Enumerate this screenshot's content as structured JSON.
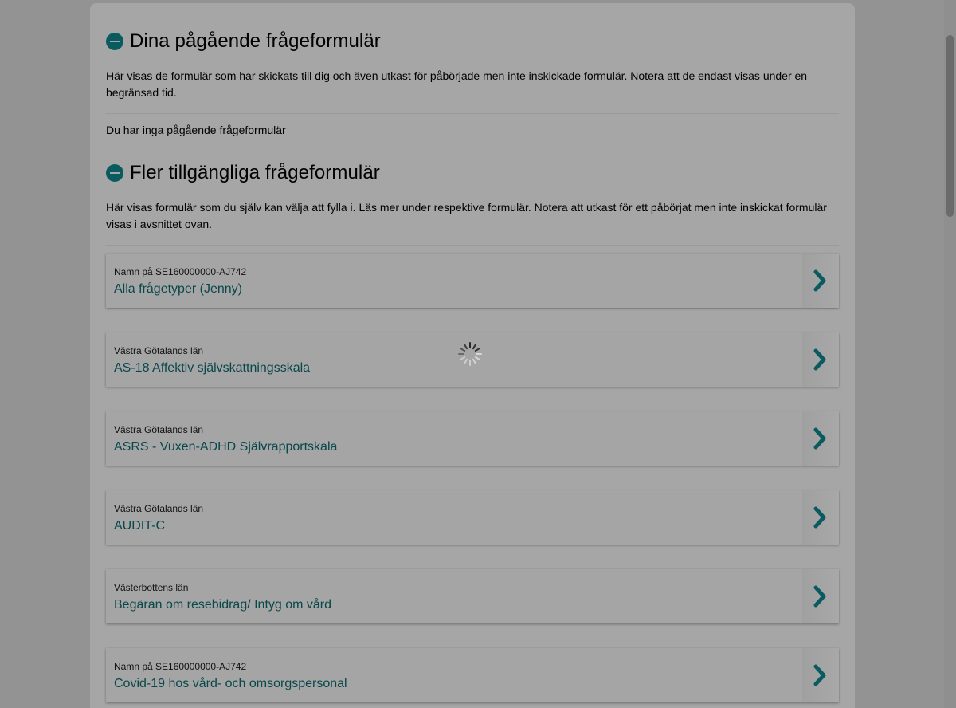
{
  "ongoing": {
    "title": "Dina pågående frågeformulär",
    "description": "Här visas de formulär som har skickats till dig och även utkast för påbörjade men inte inskickade formulär. Notera att de endast visas under en begränsad tid.",
    "empty_text": "Du har inga pågående frågeformulär"
  },
  "available": {
    "title": "Fler tillgängliga frågeformulär",
    "description": "Här visas formulär som du själv kan välja att fylla i. Läs mer under respektive formulär. Notera att utkast för ett påbörjat men inte inskickat formulär visas i avsnittet ovan.",
    "forms": [
      {
        "provider": "Namn på SE160000000-AJ742",
        "title": "Alla frågetyper (Jenny)"
      },
      {
        "provider": "Västra Götalands län",
        "title": "AS-18 Affektiv självskattningsskala"
      },
      {
        "provider": "Västra Götalands län",
        "title": "ASRS - Vuxen-ADHD Självrapportskala"
      },
      {
        "provider": "Västra Götalands län",
        "title": "AUDIT-C"
      },
      {
        "provider": "Västerbottens län",
        "title": "Begäran om resebidrag/ Intyg om vård"
      },
      {
        "provider": "Namn på SE160000000-AJ742",
        "title": "Covid-19 hos vård- och omsorgspersonal"
      }
    ]
  },
  "icons": {
    "collapse": "minus-circle-icon",
    "form_arrow": "chevron-right-icon",
    "loading": "loading-spinner-icon"
  },
  "colors": {
    "accent": "#0a5b60",
    "link": "#08474b",
    "overlay_background": "#939393",
    "panel_background": "#a6a6a6"
  }
}
